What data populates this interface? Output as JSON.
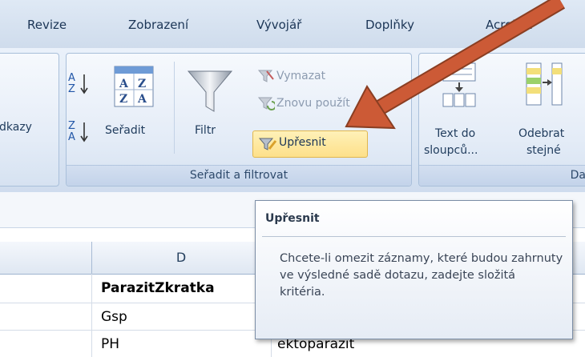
{
  "tabs": [
    "Revize",
    "Zobrazení",
    "Vývojář",
    "Doplňky",
    "Acrobat"
  ],
  "left_group_fragment": "dkazy",
  "sort_filter_group": {
    "label": "Seřadit a filtrovat",
    "sort_az_button": "",
    "sort_za_button": "",
    "sort_button": "Seřadit",
    "filter_button": "Filtr",
    "clear_button": "Vymazat",
    "reapply_button": "Znovu použít",
    "advanced_button": "Upřesnit"
  },
  "data_tools_group": {
    "label": "Da",
    "text_to_columns_line1": "Text do",
    "text_to_columns_line2": "sloupců...",
    "remove_dup_line1": "Odebrat",
    "remove_dup_line2": "stejné"
  },
  "grid": {
    "column_header": "D",
    "cells": [
      "ParazitZkratka",
      "Gsp",
      "PH"
    ],
    "cell_e3": "ektoparazit"
  },
  "tooltip": {
    "title": "Upřesnit",
    "body": "Chcete-li omezit záznamy, které budou zahrnuty ve výsledné sadě dotazu, zadejte složitá kritéria."
  },
  "colors": {
    "arrow": "#cc5a36",
    "highlight": "#fde28a"
  }
}
